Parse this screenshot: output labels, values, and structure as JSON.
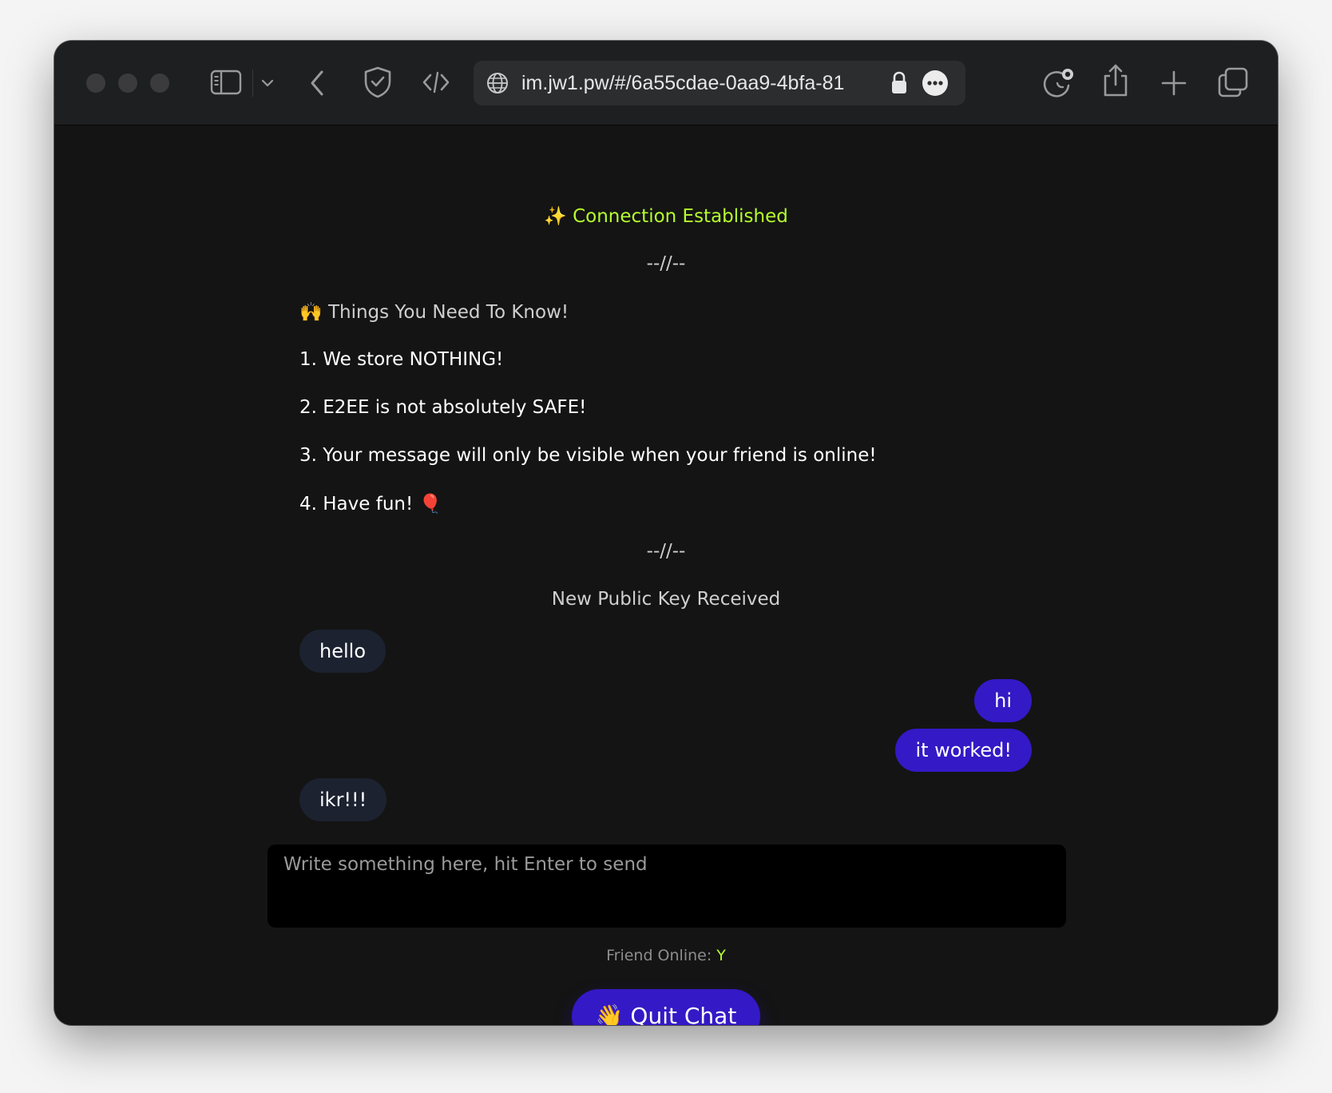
{
  "browser": {
    "url": "im.jw1.pw/#/6a55cdae-0aa9-4bfa-81",
    "icons": [
      "sidebar-icon",
      "chevron-down-icon",
      "back-icon",
      "shield-icon",
      "code-icon",
      "globe-icon",
      "lock-icon",
      "more-icon",
      "extension-icon",
      "share-icon",
      "new-tab-icon",
      "tabs-icon"
    ]
  },
  "chat": {
    "connection": "✨ Connection Established",
    "divider_top": "--//--",
    "notice_title": "🙌 Things You Need To Know!",
    "rules": [
      "1. We store NOTHING!",
      "2. E2EE is not absolutely SAFE!",
      "3. Your message will only be visible when your friend is online!",
      "4. Have fun! 🎈"
    ],
    "divider_bottom": "--//--",
    "key_notice": "New Public Key Received",
    "messages": [
      {
        "direction": "in",
        "text": "hello"
      },
      {
        "direction": "out",
        "text": "hi"
      },
      {
        "direction": "out",
        "text": "it worked!"
      },
      {
        "direction": "in",
        "text": "ikr!!!"
      }
    ],
    "composer_placeholder": "Write something here, hit Enter to send",
    "status_label": "Friend Online: ",
    "status_value": "Y",
    "quit_label": "👋 Quit Chat"
  },
  "colors": {
    "background": "#141414",
    "accent_green": "#b6ff2e",
    "outgoing_bubble": "#3419c6",
    "incoming_bubble": "#1c2230"
  }
}
